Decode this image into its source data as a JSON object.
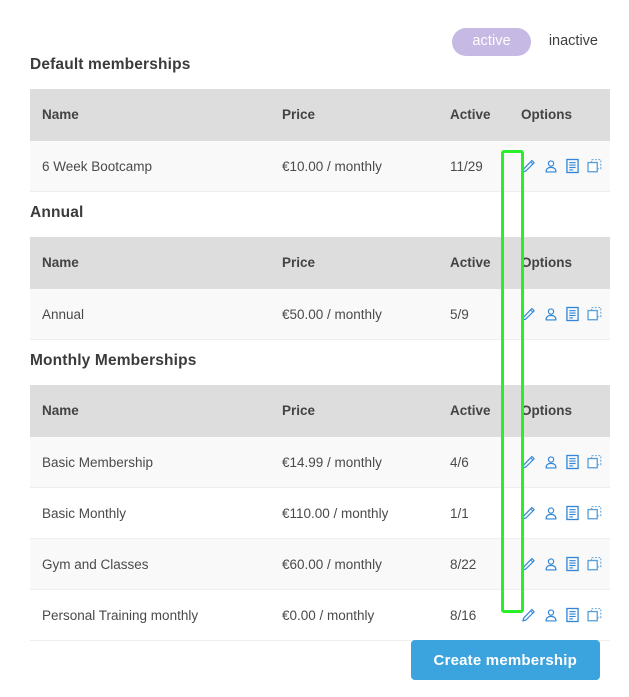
{
  "filters": {
    "active_label": "active",
    "inactive_label": "inactive",
    "active_pill_color": "#c6b9e3",
    "selected": "active"
  },
  "table_headers": {
    "name": "Name",
    "price": "Price",
    "active": "Active",
    "options": "Options"
  },
  "option_icons": [
    {
      "name": "edit-pencil-icon",
      "title": "Edit"
    },
    {
      "name": "member-person-icon",
      "title": "Members"
    },
    {
      "name": "document-list-icon",
      "title": "Details"
    },
    {
      "name": "duplicate-copy-icon",
      "title": "Duplicate"
    }
  ],
  "sections": [
    {
      "title": "Default memberships",
      "rows": [
        {
          "name": "6 Week Bootcamp",
          "price": "€10.00 / monthly",
          "active": "11/29"
        }
      ]
    },
    {
      "title": "Annual",
      "rows": [
        {
          "name": "Annual",
          "price": "€50.00 / monthly",
          "active": "5/9"
        }
      ]
    },
    {
      "title": "Monthly Memberships",
      "rows": [
        {
          "name": "Basic Membership",
          "price": "€14.99 / monthly",
          "active": "4/6"
        },
        {
          "name": "Basic Monthly",
          "price": "€110.00 / monthly",
          "active": "1/1"
        },
        {
          "name": "Gym and Classes",
          "price": "€60.00 / monthly",
          "active": "8/22"
        },
        {
          "name": "Personal Training monthly",
          "price": "€0.00 / monthly",
          "active": "8/16"
        }
      ]
    }
  ],
  "footer": {
    "create_button_label": "Create membership",
    "create_button_color": "#3ba3dd"
  },
  "annotation": {
    "highlight_color": "#2aee2a",
    "highlight_target": "edit-pencil-icon-column"
  }
}
